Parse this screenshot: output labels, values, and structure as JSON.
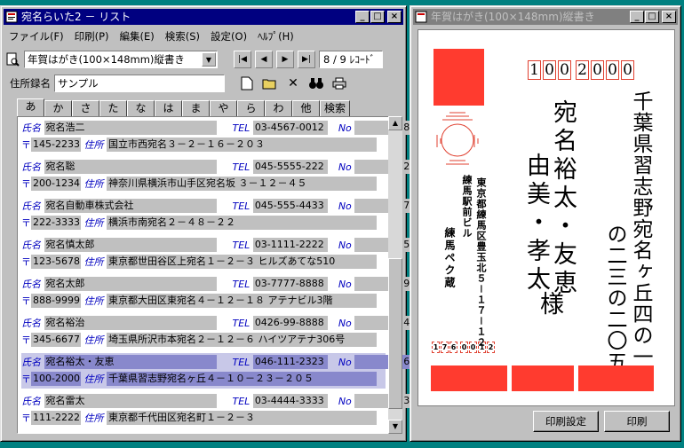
{
  "left_window": {
    "title": "宛名らいた2 － リスト",
    "menu": [
      "ファイル(F)",
      "印刷(P)",
      "編集(E)",
      "検索(S)",
      "設定(O)",
      "ﾍﾙﾌﾟ(H)"
    ],
    "format_select": "年賀はがき(100×148mm)縦書き",
    "record_counter": "8 / 9 ﾚｺｰﾄﾞ",
    "address_book_label": "住所録名",
    "address_book_name": "サンプル",
    "tabs": [
      "あ",
      "か",
      "さ",
      "た",
      "な",
      "は",
      "ま",
      "や",
      "ら",
      "わ",
      "他",
      "検索"
    ],
    "labels": {
      "name": "氏名",
      "tel": "TEL",
      "no": "No",
      "zip": "〒",
      "addr": "住所"
    },
    "records": [
      {
        "name": "宛名浩二",
        "tel": "03-4567-0012",
        "no": "8",
        "zip": "145-2233",
        "addr": "国立市西宛名３－２－１６－２０３"
      },
      {
        "name": "宛名聡",
        "tel": "045-5555-222",
        "no": "2",
        "zip": "200-1234",
        "addr": "神奈川県横浜市山手区宛名坂 ３－１２－４５"
      },
      {
        "name": "宛名自動車株式会社",
        "tel": "045-555-4433",
        "no": "7",
        "zip": "222-3333",
        "addr": "横浜市南宛名２－４８－２２"
      },
      {
        "name": "宛名慎太郎",
        "tel": "03-1111-2222",
        "no": "5",
        "zip": "123-5678",
        "addr": "東京都世田谷区上宛名１－２－３ ヒルズあてな510"
      },
      {
        "name": "宛名太郎",
        "tel": "03-7777-8888",
        "no": "9",
        "zip": "888-9999",
        "addr": "東京都大田区東宛名４－１２－１８ アテナビル3階"
      },
      {
        "name": "宛名裕治",
        "tel": "0426-99-8888",
        "no": "4",
        "zip": "345-6677",
        "addr": "埼玉県所沢市本宛名２－１２－６ ハイツアテナ306号"
      },
      {
        "name": "宛名裕太・友恵",
        "tel": "046-111-2323",
        "no": "6",
        "zip": "100-2000",
        "addr": "千葉県習志野宛名ヶ丘４－１０－２３－２０５"
      },
      {
        "name": "宛名雷太",
        "tel": "03-4444-3333",
        "no": "3",
        "zip": "111-2222",
        "addr": "東京都千代田区宛名町１－２－３"
      }
    ]
  },
  "right_window": {
    "title": "年賀はがき(100×148mm)縦書き",
    "zip_digits": [
      "1",
      "0",
      "0",
      "2",
      "0",
      "0",
      "0"
    ],
    "address_line1": "千葉県習志野宛名ヶ丘四の一〇",
    "address_line2": "の二三の二〇五",
    "recipient_first": "宛名裕太・友恵",
    "recipient_second": "由美・孝太",
    "honorific": "様",
    "sender_address1": "東京都練馬区豊玉北５－１７－１２",
    "sender_address2": "練馬駅前ビル",
    "sender_name": "練馬ペク蔵",
    "sender_zip_digits": [
      "1",
      "7",
      "6",
      "0",
      "0",
      "1",
      "2"
    ],
    "print_settings_button": "印刷設定",
    "print_button": "印刷"
  },
  "colors": {
    "stamp": "#ff3b2f",
    "zip_border": "#e04030",
    "titlebar_active": "#000080",
    "titlebar_inactive": "#808080",
    "field_label": "#0000c0"
  }
}
